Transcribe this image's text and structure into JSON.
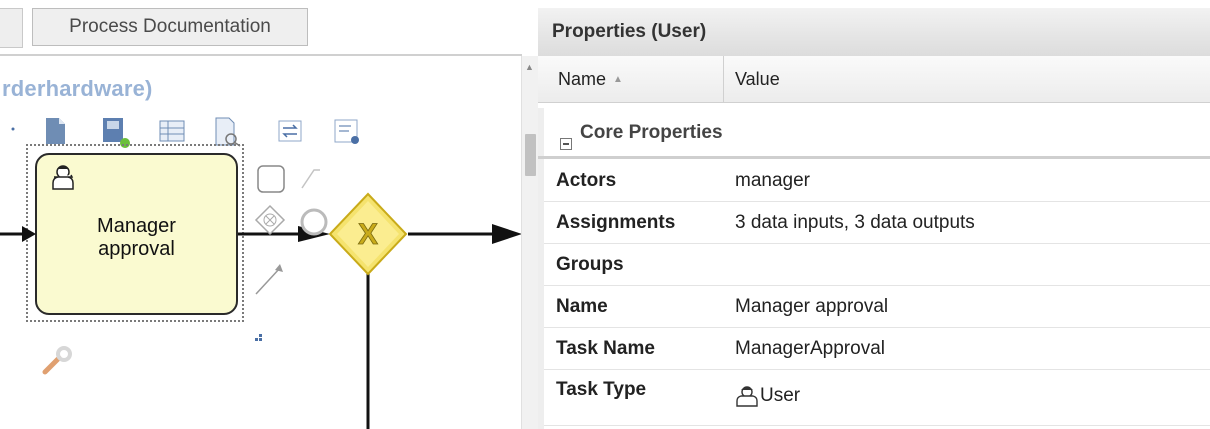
{
  "tabs": {
    "active_label": "Process Documentation"
  },
  "canvas": {
    "process_title": "rderhardware)",
    "task": {
      "label_line1": "Manager",
      "label_line2": "approval"
    },
    "gateway": {
      "symbol": "X",
      "fill": "#f5e36e"
    },
    "toolbar_icons": [
      "document-icon",
      "save-icon",
      "table-icon",
      "print-preview-icon",
      "swap-icon",
      "form-icon"
    ],
    "context_menu_icons": [
      "task-shape-icon",
      "connector-icon",
      "gateway-icon",
      "event-icon",
      "arrow-icon",
      "wrench-icon"
    ]
  },
  "properties": {
    "title": "Properties (User)",
    "columns": {
      "name": "Name",
      "value": "Value"
    },
    "group": "Core Properties",
    "rows": [
      {
        "key": "Actors",
        "value": "manager"
      },
      {
        "key": "Assignments",
        "value": "3 data inputs, 3 data outputs"
      },
      {
        "key": "Groups",
        "value": ""
      },
      {
        "key": "Name",
        "value": "Manager approval"
      },
      {
        "key": "Task Name",
        "value": "ManagerApproval"
      },
      {
        "key": "Task Type",
        "value": "User"
      }
    ]
  },
  "colors": {
    "title_blue": "#99b3d6",
    "task_fill": "#fafad0",
    "accent": "#dcdcdc"
  }
}
